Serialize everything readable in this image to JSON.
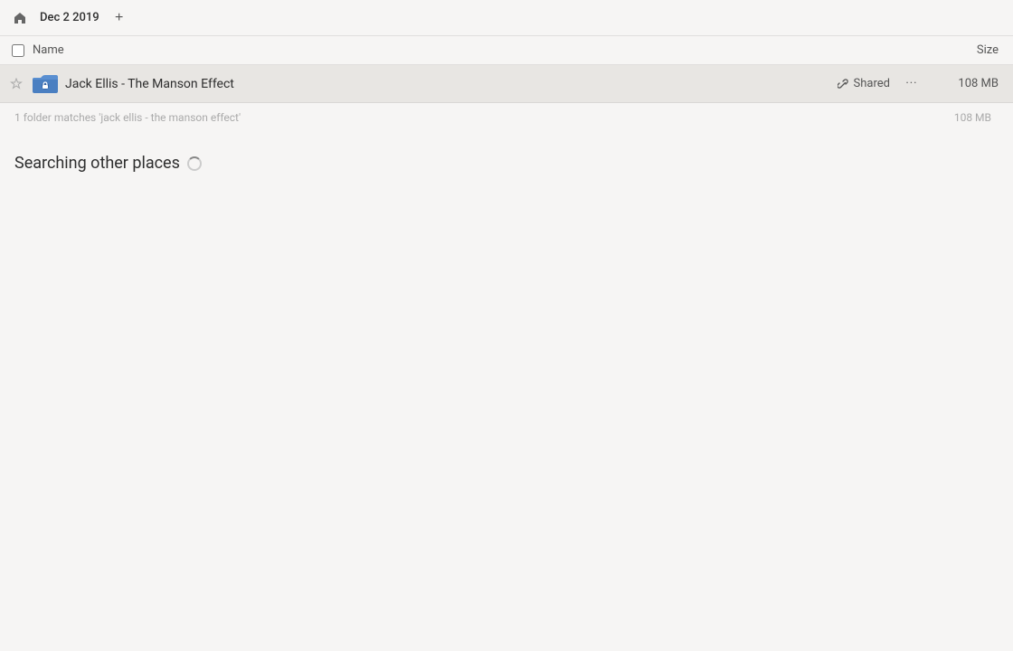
{
  "topbar": {
    "home_icon": "⌂",
    "breadcrumb": "Dec 2 2019",
    "new_tab_icon": "+"
  },
  "columns": {
    "name_label": "Name",
    "size_label": "Size"
  },
  "file_row": {
    "name": "Jack Ellis - The Manson Effect",
    "shared_label": "Shared",
    "more_icon": "···",
    "size": "108 MB"
  },
  "summary": {
    "text": "1 folder matches 'jack ellis - the manson effect'",
    "size": "108 MB"
  },
  "searching": {
    "label": "Searching other places"
  },
  "colors": {
    "accent": "#3d6ec4",
    "folder_blue": "#4a7fc1",
    "folder_dark": "#2a5799"
  }
}
